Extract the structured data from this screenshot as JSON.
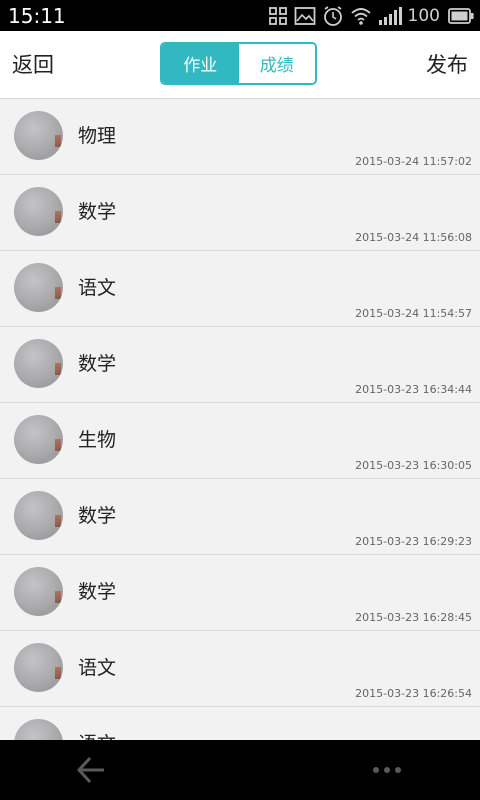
{
  "status_bar": {
    "time": "15:11",
    "battery_level": "100",
    "icons": [
      "grid-icon",
      "image-icon",
      "alarm-icon",
      "wifi-icon",
      "signal-icon",
      "battery-icon"
    ]
  },
  "header": {
    "back_label": "返回",
    "publish_label": "发布",
    "tabs": [
      {
        "label": "作业",
        "active": true
      },
      {
        "label": "成绩",
        "active": false
      }
    ]
  },
  "list": {
    "items": [
      {
        "subject": "物理",
        "time": "2015-03-24 11:57:02"
      },
      {
        "subject": "数学",
        "time": "2015-03-24 11:56:08"
      },
      {
        "subject": "语文",
        "time": "2015-03-24 11:54:57"
      },
      {
        "subject": "数学",
        "time": "2015-03-23 16:34:44"
      },
      {
        "subject": "生物",
        "time": "2015-03-23 16:30:05"
      },
      {
        "subject": "数学",
        "time": "2015-03-23 16:29:23"
      },
      {
        "subject": "数学",
        "time": "2015-03-23 16:28:45"
      },
      {
        "subject": "语文",
        "time": "2015-03-23 16:26:54"
      },
      {
        "subject": "语文",
        "time": ""
      }
    ]
  },
  "nav_bar": {
    "icons": [
      "back-arrow-icon",
      "more-icon"
    ]
  },
  "colors": {
    "accent": "#31b8c0",
    "list_background": "#f2f2f2",
    "header_background": "#ffffff"
  }
}
